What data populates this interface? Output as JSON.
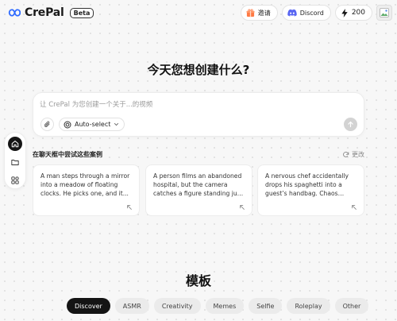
{
  "brand": {
    "name": "CrePal",
    "badge": "Beta"
  },
  "header": {
    "invite_label": "邀请",
    "discord_label": "Discord",
    "credits": "200"
  },
  "headline": "今天您想创建什么?",
  "prompt": {
    "placeholder": "让 CrePal 为您创建一个关于...的视频",
    "model_label": "Auto-select"
  },
  "examples": {
    "title": "在聊天框中尝试这些案例",
    "refresh_label": "更改",
    "cards": [
      {
        "text": "A man steps through a mirror into a meadow of floating clocks. He picks one, and it..."
      },
      {
        "text": "A person films an abandoned hospital, but the camera catches a figure standing just behind..."
      },
      {
        "text": "A nervous chef accidentally drops his spaghetti into a guest’s handbag. Chaos ensu..."
      }
    ]
  },
  "templates": {
    "title": "模板",
    "tabs": [
      "Discover",
      "ASMR",
      "Creativity",
      "Memes",
      "Selfie",
      "Roleplay",
      "Other"
    ],
    "active_tab": "Discover"
  },
  "colors": {
    "accent": "#141414",
    "background": "#f7f7f7",
    "logo": "#2f6bff"
  }
}
